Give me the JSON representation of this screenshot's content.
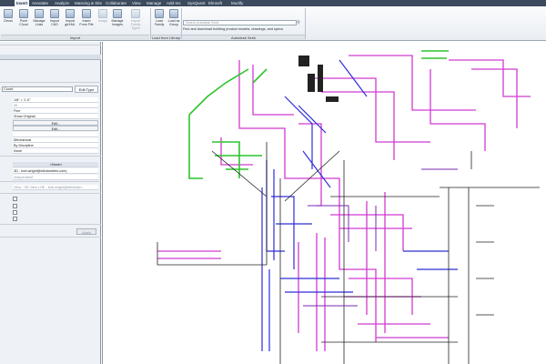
{
  "ribbon": {
    "tabs": [
      "Insert",
      "Annotate",
      "Analyze",
      "Massing & Site",
      "Collaborate",
      "View",
      "Manage",
      "Add-Ins",
      "SysQuest",
      "Elmsoft",
      "Modify"
    ],
    "active_tab": "Insert",
    "buttons": {
      "decal": "Decal",
      "point_cloud": "Point\nCloud",
      "manage_links": "Manage\nLinks",
      "import_cad": "Import\nCAD",
      "import_gbxml": "Import\ngbXML",
      "insert_from_file": "Insert\nFrom File",
      "image": "Image",
      "manage_images": "Manage\nImages",
      "import_family_types": "Import\nFamily Types",
      "load_family": "Load\nFamily",
      "load_as_group": "Load as\nGroup"
    },
    "groups": {
      "import": "Import",
      "load_from_library": "Load from Library",
      "autodesk_seek": "Autodesk Seek"
    },
    "search_placeholder": "Search Autodesk Seek",
    "seek_description": "Find and download building product models, drawings, and specs"
  },
  "properties": {
    "type_value": "Coord",
    "edit_type_label": "Edit Type",
    "rows": [
      {
        "value": "1/8\" = 1'-0\""
      },
      {
        "value": "96"
      },
      {
        "value": "Fine"
      },
      {
        "value": "Show Original"
      },
      {
        "value": "Edit...",
        "button": true
      },
      {
        "value": "Edit...",
        "button": true
      },
      {
        "value": ""
      },
      {
        "value": "Mechanical"
      },
      {
        "value": "By Discipline"
      },
      {
        "value": "None"
      }
    ],
    "none_label": "<None>",
    "owner_value": "3D - bob.wright@tdindustries.com)",
    "dependency_value": "Independent",
    "view_template_value": "View: \"3D View LOE - bob.wright@tdindustri...",
    "apply_label": "Apply"
  },
  "colors": {
    "magenta": "#d13ad1",
    "green": "#2dc42d",
    "blue": "#2d2dd8",
    "black": "#222222",
    "purple": "#7a2ab0"
  }
}
